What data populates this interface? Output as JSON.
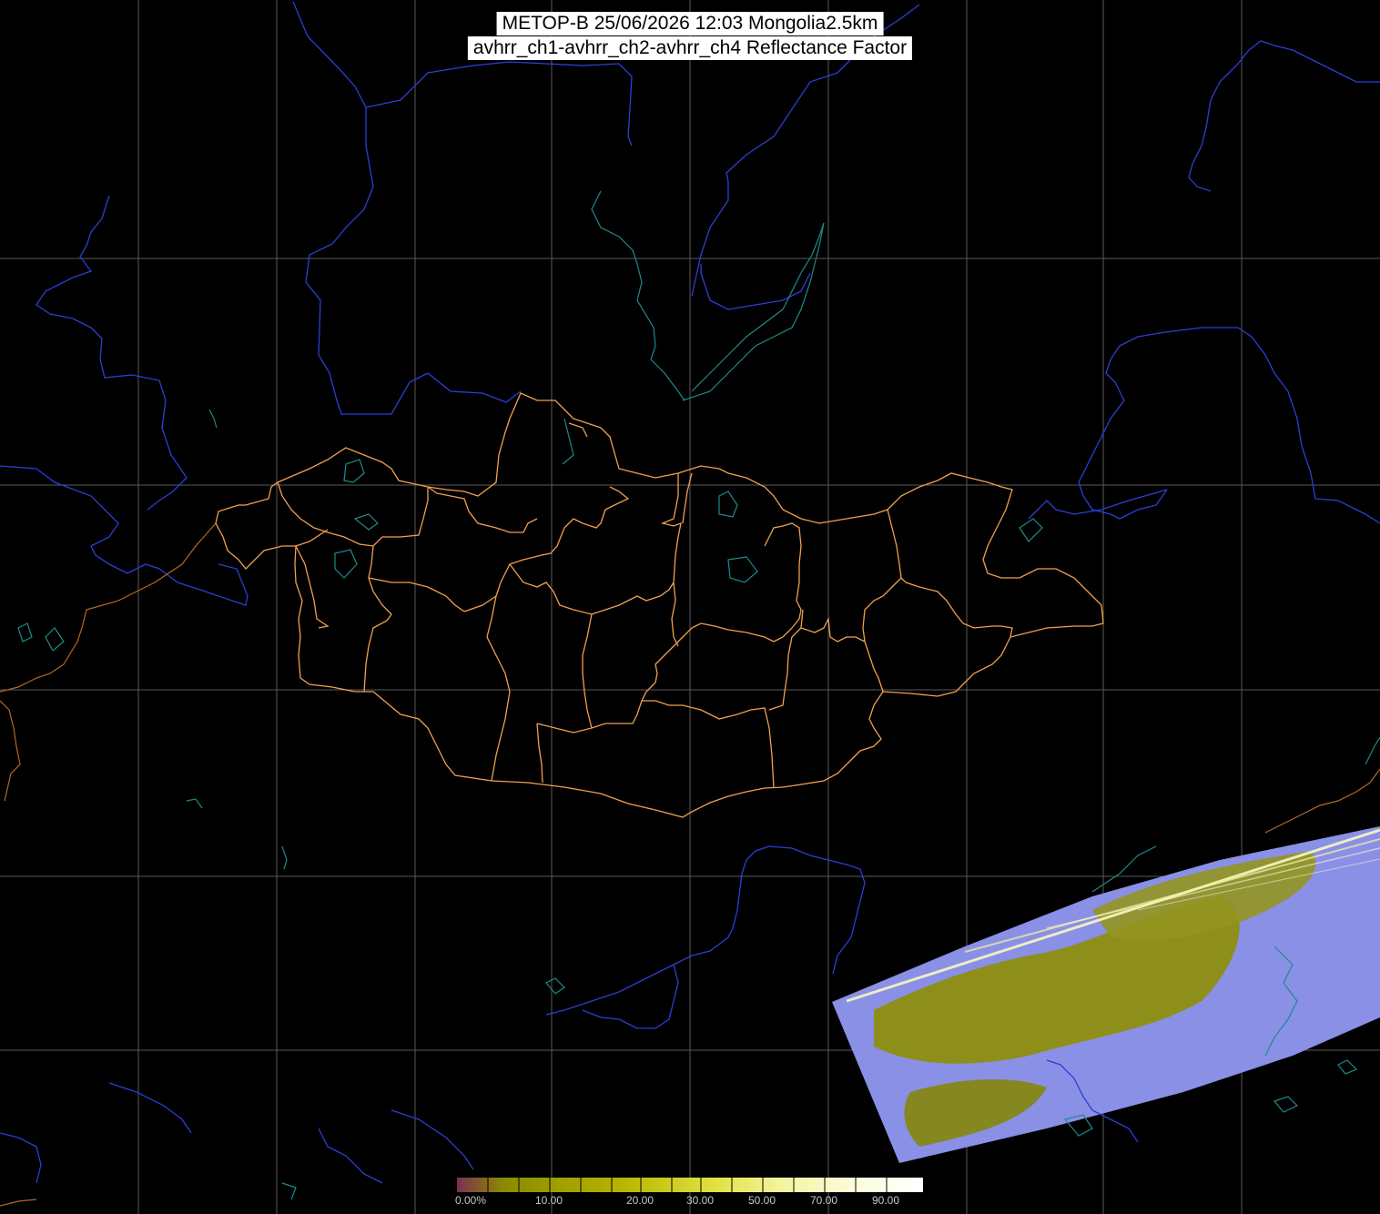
{
  "title": {
    "line1": "METOP-B 25/06/2026 12:03 Mongolia2.5km",
    "line2": "avhrr_ch1-avhrr_ch2-avhrr_ch4 Reflectance Factor"
  },
  "colors": {
    "background": "#000000",
    "graticule": "#5a5a5a",
    "coastlines_rivers": "#2b3fd6",
    "lakes": "#1f8a8a",
    "mongolia_borders": "#f0a050",
    "neighbor_border": "#b06a28",
    "swath_land": "#8d8f1a",
    "swath_cloud": "#8a90e6"
  },
  "colorbar": {
    "ticks": [
      "0.00%",
      "10.00",
      "20.00",
      "30.00",
      "50.00",
      "70.00",
      "90.00"
    ],
    "stops": [
      "#7a3050",
      "#8a8a00",
      "#b4b400",
      "#d8d800",
      "#f0f070",
      "#f8f8b0",
      "#ffffe0",
      "#ffffff"
    ]
  }
}
